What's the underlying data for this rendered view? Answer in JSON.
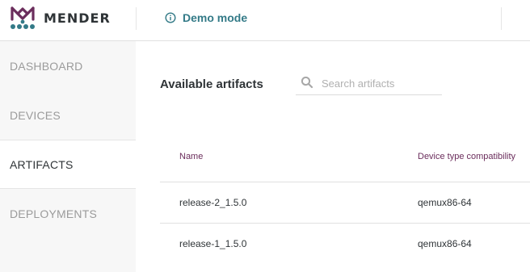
{
  "header": {
    "brand": "MENDER",
    "demo_mode": "Demo mode"
  },
  "sidebar": {
    "items": [
      {
        "label": "DASHBOARD"
      },
      {
        "label": "DEVICES"
      },
      {
        "label": "ARTIFACTS"
      },
      {
        "label": "DEPLOYMENTS"
      }
    ],
    "active": "ARTIFACTS"
  },
  "main": {
    "title": "Available artifacts",
    "search": {
      "placeholder": "Search artifacts"
    },
    "table": {
      "columns": [
        "Name",
        "Device type compatibility"
      ],
      "rows": [
        {
          "name": "release-2_1.5.0",
          "device_type": "qemux86-64"
        },
        {
          "name": "release-1_1.5.0",
          "device_type": "qemux86-64"
        }
      ]
    }
  },
  "colors": {
    "brand": "#6b2d5c",
    "accent": "#337a87",
    "logo_teal": "#337a87",
    "logo_purple": "#6b2d5c"
  }
}
